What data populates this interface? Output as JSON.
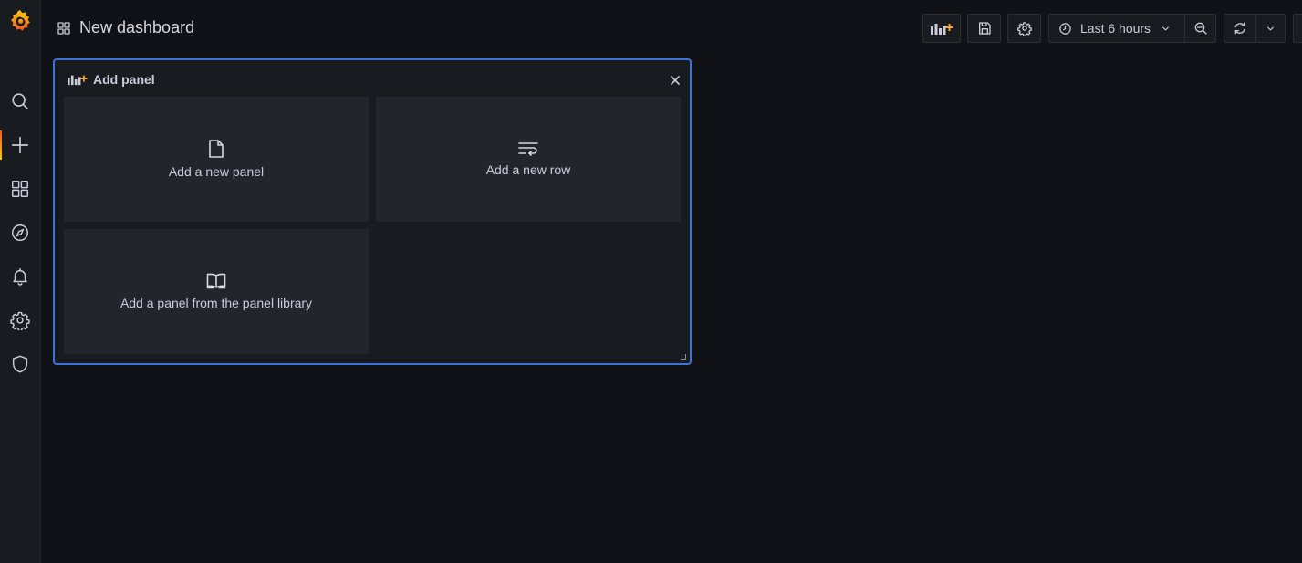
{
  "header": {
    "title": "New dashboard"
  },
  "toolbar": {
    "time_range": "Last 6 hours"
  },
  "add_panel": {
    "title": "Add panel",
    "options": [
      {
        "label": "Add a new panel",
        "icon": "file-icon"
      },
      {
        "label": "Add a new row",
        "icon": "wrap-text-icon"
      },
      {
        "label": "Add a panel from the panel library",
        "icon": "book-open-icon"
      }
    ]
  },
  "sidebar": {
    "items": [
      {
        "icon": "search-icon"
      },
      {
        "icon": "plus-icon",
        "active": true
      },
      {
        "icon": "dashboards-icon"
      },
      {
        "icon": "compass-icon"
      },
      {
        "icon": "bell-icon"
      },
      {
        "icon": "gear-icon"
      },
      {
        "icon": "shield-icon"
      }
    ]
  },
  "colors": {
    "background": "#111217",
    "panel_border": "#3d71d9",
    "accent_orange": "#f5a623",
    "active_bar": "#f05a28"
  }
}
